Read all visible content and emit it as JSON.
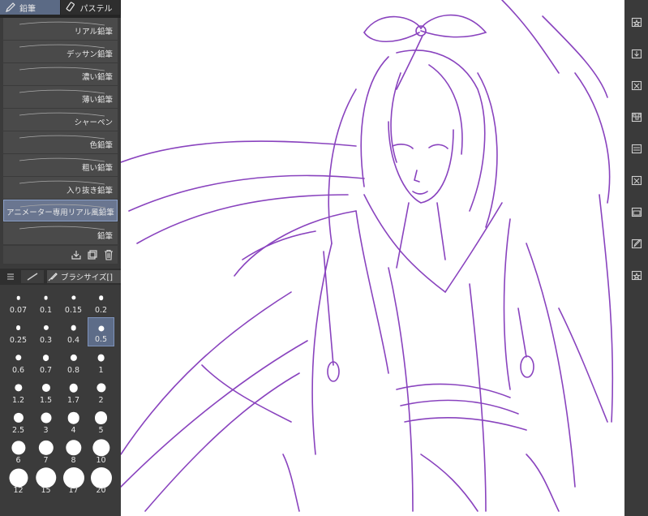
{
  "tabs": [
    {
      "label": "鉛筆",
      "icon": "pencil-icon",
      "active": true
    },
    {
      "label": "パステル",
      "icon": "pastel-icon",
      "active": false
    }
  ],
  "brush_list": [
    {
      "label": "リアル鉛筆"
    },
    {
      "label": "デッサン鉛筆"
    },
    {
      "label": "濃い鉛筆"
    },
    {
      "label": "薄い鉛筆"
    },
    {
      "label": "シャーペン"
    },
    {
      "label": "色鉛筆"
    },
    {
      "label": "粗い鉛筆"
    },
    {
      "label": "入り抜き鉛筆"
    },
    {
      "label": "アニメーター専用リアル風鉛筆",
      "selected": true
    },
    {
      "label": "鉛筆"
    }
  ],
  "list_toolbar": {
    "icons": [
      "import-icon",
      "duplicate-icon",
      "trash-icon"
    ]
  },
  "brush_size": {
    "title": "ブラシサイズ[]",
    "sizes": [
      "0.07",
      "0.1",
      "0.15",
      "0.2",
      "0.25",
      "0.3",
      "0.4",
      "0.5",
      "0.6",
      "0.7",
      "0.8",
      "1",
      "1.2",
      "1.5",
      "1.7",
      "2",
      "2.5",
      "3",
      "4",
      "5",
      "6",
      "7",
      "8",
      "10",
      "12",
      "15",
      "17",
      "20"
    ],
    "selected": "0.5"
  },
  "right_bar": {
    "icons": [
      "star-folder-icon",
      "download-icon",
      "close-box-icon",
      "checker-icon",
      "layer-icon",
      "resize-icon",
      "folder-icon",
      "edit-icon",
      "star-folder-icon"
    ]
  },
  "colors": {
    "sketch": "#7d2fb8",
    "panel": "#3b3b3b",
    "selected": "#5b6a85"
  }
}
